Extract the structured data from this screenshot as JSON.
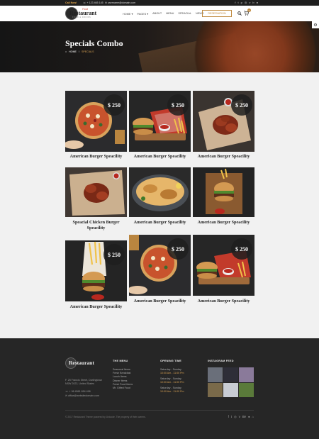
{
  "topbar": {
    "call_label": "Call Now!",
    "phone": "+ 123 465 145",
    "email": "username@domain.com",
    "social_icons": [
      "facebook-icon",
      "twitter-icon",
      "pinterest-icon",
      "instagram-icon",
      "vimeo-icon",
      "behance-icon",
      "dribbble-icon"
    ]
  },
  "header": {
    "logo_word": "Restaurant",
    "logo_tag": "Food",
    "logo_sub": "FOOD & DRINKS",
    "nav": [
      "HOME ▾",
      "PAGES ▾",
      "ABOUT",
      "MENU",
      "SPEACIAL",
      "NEWS"
    ],
    "reservation_label": "RESERVATION",
    "cart_count": "0"
  },
  "hero": {
    "title": "Specials Combo",
    "crumb_home": "HOME",
    "crumb_sep": "/",
    "crumb_current": "SPECIALS"
  },
  "cards": [
    {
      "price": "$ 250",
      "title": "American Burger Speacility",
      "food": "pizza"
    },
    {
      "price": "$ 250",
      "title": "American Burger Speacility",
      "food": "burger-fries"
    },
    {
      "price": "$ 250",
      "title": "American Burger Speacility",
      "food": "wings"
    },
    {
      "price": "",
      "title": "Speacial Chicken Burger Speacility",
      "food": "wings2"
    },
    {
      "price": "",
      "title": "American Burger Speacility",
      "food": "chicken"
    },
    {
      "price": "",
      "title": "American Burger Speacility",
      "food": "burger"
    },
    {
      "price": "$ 250",
      "title": "American Burger Speacility",
      "food": "burger2"
    },
    {
      "price": "$ 250",
      "title": "American Burger Speacility",
      "food": "pizza2"
    },
    {
      "price": "$ 250",
      "title": "American Burger Speacility",
      "food": "burger-fries2"
    }
  ],
  "footer": {
    "logo_word": "Restaurant",
    "address": "F. 25 Francis Street, Darlingtown NSW 2022, United States",
    "phone": "+ 96 4561 654 498",
    "email": "office@websitedomain.com",
    "menu_title": "THE MENU",
    "menu_items": [
      "Seasonal Items",
      "Fresh Breakfast",
      "Lunch Items",
      "Dinner Items",
      "Fresh Food Items",
      "Mr. Gifted Food"
    ],
    "hours_title": "OPENING TIME",
    "hours": [
      {
        "day": "Saturday - Sunday",
        "time": "10:00 Am - 11:00 Pm"
      },
      {
        "day": "Saturday - Sunday",
        "time": "10:00 Am - 11:00 Pm"
      },
      {
        "day": "Saturday - Sunday",
        "time": "10:00 Am - 11:00 Pm"
      }
    ],
    "insta_title": "INSTAGRAM FEED",
    "copyright": "© 2017 Restaurant Theme powered by Unicode. The property of their owners.",
    "social_icons": [
      "facebook-icon",
      "twitter-icon",
      "instagram-icon",
      "vimeo-icon",
      "behance-icon",
      "dribbble-icon",
      "github-icon"
    ]
  },
  "colors": {
    "accent": "#c08a3e",
    "gold": "#d9a253",
    "dark": "#262626"
  }
}
